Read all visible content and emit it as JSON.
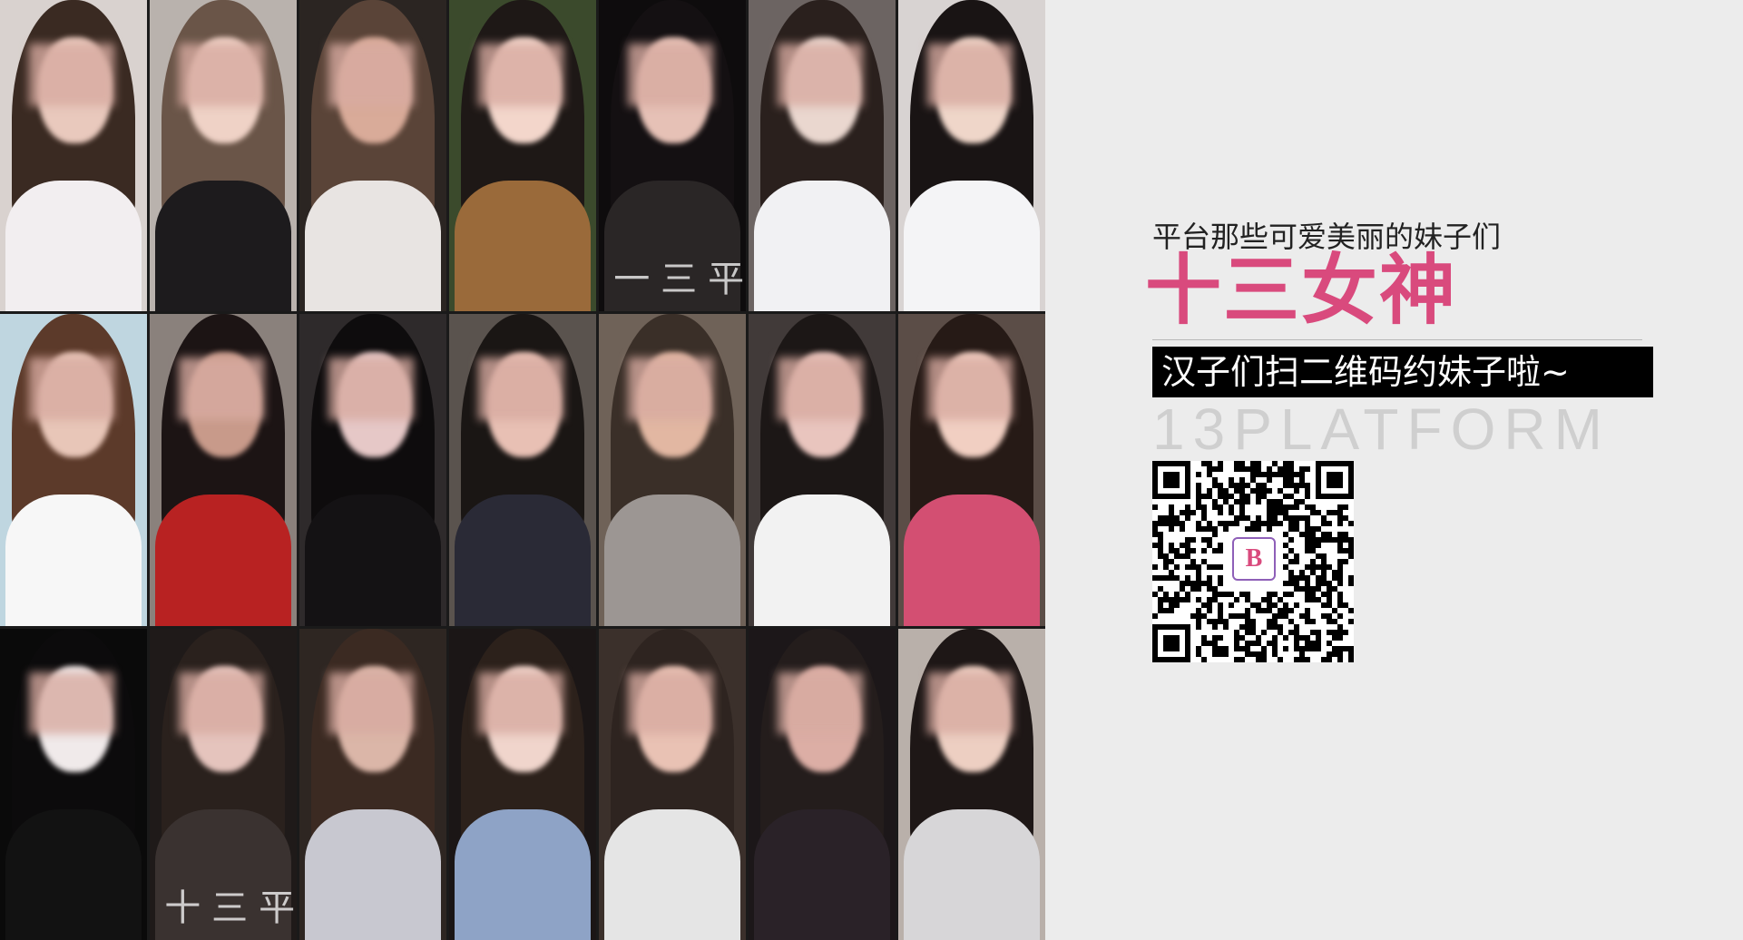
{
  "mosaic": {
    "tiles": [
      {
        "hair": "#3a2a22",
        "skin": "#e9c9bd",
        "top": "#f2eef0",
        "bg": "#d9d2cf",
        "watermark": ""
      },
      {
        "hair": "#6a5548",
        "skin": "#efd2c6",
        "top": "#1d1b1d",
        "bg": "#b9b2ad",
        "watermark": ""
      },
      {
        "hair": "#5a4438",
        "skin": "#d9ab99",
        "top": "#e8e4e2",
        "bg": "#2b2522",
        "watermark": ""
      },
      {
        "hair": "#1e1816",
        "skin": "#f3d6cb",
        "top": "#9a6a3a",
        "bg": "#3b4a2c",
        "watermark": ""
      },
      {
        "hair": "#141012",
        "skin": "#e6c1b6",
        "top": "#2a2626",
        "bg": "#0e0c0d",
        "watermark": "一三平"
      },
      {
        "hair": "#2a201d",
        "skin": "#ead7cf",
        "top": "#f1f1f3",
        "bg": "#6c6462",
        "watermark": ""
      },
      {
        "hair": "#191414",
        "skin": "#efd6c9",
        "top": "#f4f4f6",
        "bg": "#d8d3d2",
        "watermark": ""
      },
      {
        "hair": "#5c3a2a",
        "skin": "#e8c6b8",
        "top": "#f7f7f7",
        "bg": "#bfd6e0",
        "watermark": ""
      },
      {
        "hair": "#1c1414",
        "skin": "#c89a8a",
        "top": "#b82222",
        "bg": "#8a817c",
        "watermark": ""
      },
      {
        "hair": "#0e0c0d",
        "skin": "#e6c8c7",
        "top": "#141214",
        "bg": "#2e2a2b",
        "watermark": ""
      },
      {
        "hair": "#1a1614",
        "skin": "#e8c0b4",
        "top": "#2a2a36",
        "bg": "#5a534e",
        "watermark": ""
      },
      {
        "hair": "#3a2f28",
        "skin": "#e2b7a2",
        "top": "#9c9693",
        "bg": "#6f6258",
        "watermark": ""
      },
      {
        "hair": "#1c1716",
        "skin": "#e9c5be",
        "top": "#f2f2f2",
        "bg": "#413a39",
        "watermark": ""
      },
      {
        "hair": "#261a16",
        "skin": "#f1cfc2",
        "top": "#d34f72",
        "bg": "#5b4d47",
        "watermark": ""
      },
      {
        "hair": "#0c0b0c",
        "skin": "#f0eaea",
        "top": "#121212",
        "bg": "#0a0a0a",
        "watermark": ""
      },
      {
        "hair": "#2a211d",
        "skin": "#e5c4bd",
        "top": "#3a3230",
        "bg": "#1f1a19",
        "watermark": "十三平"
      },
      {
        "hair": "#3b2a22",
        "skin": "#dbb6a8",
        "top": "#c8c8d0",
        "bg": "#2e2622",
        "watermark": ""
      },
      {
        "hair": "#2c211b",
        "skin": "#f0d5cc",
        "top": "#8ea3c6",
        "bg": "#1b1616",
        "watermark": ""
      },
      {
        "hair": "#2e2420",
        "skin": "#e9c2b4",
        "top": "#e5e5e5",
        "bg": "#3b302b",
        "watermark": ""
      },
      {
        "hair": "#241d1c",
        "skin": "#dcaea5",
        "top": "#2a2228",
        "bg": "#1c1719",
        "watermark": ""
      },
      {
        "hair": "#1e1716",
        "skin": "#edcfc2",
        "top": "#d7d6d8",
        "bg": "#b9b0aa",
        "watermark": ""
      }
    ]
  },
  "panel": {
    "subtitle": "平台那些可爱美丽的妹子们",
    "title": "十三女神",
    "banner": "汉子们扫二维码约妹子啦~",
    "brand": "13PLATFORM",
    "qr_logo_letter": "B"
  },
  "colors": {
    "accent": "#d94a7d",
    "banner_bg": "#000000",
    "brand_text": "#cfcfcf"
  },
  "icons": {
    "qr": "qr-code-icon",
    "logo": "brand-logo-icon"
  }
}
